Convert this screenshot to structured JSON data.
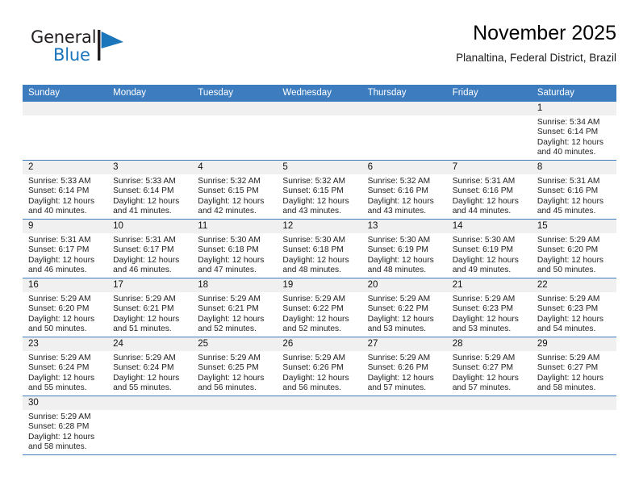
{
  "brand": {
    "name_dark": "General",
    "name_blue": "Blue",
    "flag_color": "#1b75bb"
  },
  "header": {
    "title": "November 2025",
    "subtitle": "Planaltina, Federal District, Brazil"
  },
  "theme": {
    "header_blue": "#3d7cbf",
    "daynum_gray": "#f0f0f0",
    "text": "#222222"
  },
  "weekdays": [
    "Sunday",
    "Monday",
    "Tuesday",
    "Wednesday",
    "Thursday",
    "Friday",
    "Saturday"
  ],
  "labels": {
    "sunrise_prefix": "Sunrise:",
    "sunset_prefix": "Sunset:",
    "daylight_prefix": "Daylight:"
  },
  "weeks": [
    [
      {
        "day": "",
        "sunrise": "",
        "sunset": "",
        "daylight_line1": "",
        "daylight_line2": ""
      },
      {
        "day": "",
        "sunrise": "",
        "sunset": "",
        "daylight_line1": "",
        "daylight_line2": ""
      },
      {
        "day": "",
        "sunrise": "",
        "sunset": "",
        "daylight_line1": "",
        "daylight_line2": ""
      },
      {
        "day": "",
        "sunrise": "",
        "sunset": "",
        "daylight_line1": "",
        "daylight_line2": ""
      },
      {
        "day": "",
        "sunrise": "",
        "sunset": "",
        "daylight_line1": "",
        "daylight_line2": ""
      },
      {
        "day": "",
        "sunrise": "",
        "sunset": "",
        "daylight_line1": "",
        "daylight_line2": ""
      },
      {
        "day": "1",
        "sunrise": "Sunrise: 5:34 AM",
        "sunset": "Sunset: 6:14 PM",
        "daylight_line1": "Daylight: 12 hours",
        "daylight_line2": "and 40 minutes."
      }
    ],
    [
      {
        "day": "2",
        "sunrise": "Sunrise: 5:33 AM",
        "sunset": "Sunset: 6:14 PM",
        "daylight_line1": "Daylight: 12 hours",
        "daylight_line2": "and 40 minutes."
      },
      {
        "day": "3",
        "sunrise": "Sunrise: 5:33 AM",
        "sunset": "Sunset: 6:14 PM",
        "daylight_line1": "Daylight: 12 hours",
        "daylight_line2": "and 41 minutes."
      },
      {
        "day": "4",
        "sunrise": "Sunrise: 5:32 AM",
        "sunset": "Sunset: 6:15 PM",
        "daylight_line1": "Daylight: 12 hours",
        "daylight_line2": "and 42 minutes."
      },
      {
        "day": "5",
        "sunrise": "Sunrise: 5:32 AM",
        "sunset": "Sunset: 6:15 PM",
        "daylight_line1": "Daylight: 12 hours",
        "daylight_line2": "and 43 minutes."
      },
      {
        "day": "6",
        "sunrise": "Sunrise: 5:32 AM",
        "sunset": "Sunset: 6:16 PM",
        "daylight_line1": "Daylight: 12 hours",
        "daylight_line2": "and 43 minutes."
      },
      {
        "day": "7",
        "sunrise": "Sunrise: 5:31 AM",
        "sunset": "Sunset: 6:16 PM",
        "daylight_line1": "Daylight: 12 hours",
        "daylight_line2": "and 44 minutes."
      },
      {
        "day": "8",
        "sunrise": "Sunrise: 5:31 AM",
        "sunset": "Sunset: 6:16 PM",
        "daylight_line1": "Daylight: 12 hours",
        "daylight_line2": "and 45 minutes."
      }
    ],
    [
      {
        "day": "9",
        "sunrise": "Sunrise: 5:31 AM",
        "sunset": "Sunset: 6:17 PM",
        "daylight_line1": "Daylight: 12 hours",
        "daylight_line2": "and 46 minutes."
      },
      {
        "day": "10",
        "sunrise": "Sunrise: 5:31 AM",
        "sunset": "Sunset: 6:17 PM",
        "daylight_line1": "Daylight: 12 hours",
        "daylight_line2": "and 46 minutes."
      },
      {
        "day": "11",
        "sunrise": "Sunrise: 5:30 AM",
        "sunset": "Sunset: 6:18 PM",
        "daylight_line1": "Daylight: 12 hours",
        "daylight_line2": "and 47 minutes."
      },
      {
        "day": "12",
        "sunrise": "Sunrise: 5:30 AM",
        "sunset": "Sunset: 6:18 PM",
        "daylight_line1": "Daylight: 12 hours",
        "daylight_line2": "and 48 minutes."
      },
      {
        "day": "13",
        "sunrise": "Sunrise: 5:30 AM",
        "sunset": "Sunset: 6:19 PM",
        "daylight_line1": "Daylight: 12 hours",
        "daylight_line2": "and 48 minutes."
      },
      {
        "day": "14",
        "sunrise": "Sunrise: 5:30 AM",
        "sunset": "Sunset: 6:19 PM",
        "daylight_line1": "Daylight: 12 hours",
        "daylight_line2": "and 49 minutes."
      },
      {
        "day": "15",
        "sunrise": "Sunrise: 5:29 AM",
        "sunset": "Sunset: 6:20 PM",
        "daylight_line1": "Daylight: 12 hours",
        "daylight_line2": "and 50 minutes."
      }
    ],
    [
      {
        "day": "16",
        "sunrise": "Sunrise: 5:29 AM",
        "sunset": "Sunset: 6:20 PM",
        "daylight_line1": "Daylight: 12 hours",
        "daylight_line2": "and 50 minutes."
      },
      {
        "day": "17",
        "sunrise": "Sunrise: 5:29 AM",
        "sunset": "Sunset: 6:21 PM",
        "daylight_line1": "Daylight: 12 hours",
        "daylight_line2": "and 51 minutes."
      },
      {
        "day": "18",
        "sunrise": "Sunrise: 5:29 AM",
        "sunset": "Sunset: 6:21 PM",
        "daylight_line1": "Daylight: 12 hours",
        "daylight_line2": "and 52 minutes."
      },
      {
        "day": "19",
        "sunrise": "Sunrise: 5:29 AM",
        "sunset": "Sunset: 6:22 PM",
        "daylight_line1": "Daylight: 12 hours",
        "daylight_line2": "and 52 minutes."
      },
      {
        "day": "20",
        "sunrise": "Sunrise: 5:29 AM",
        "sunset": "Sunset: 6:22 PM",
        "daylight_line1": "Daylight: 12 hours",
        "daylight_line2": "and 53 minutes."
      },
      {
        "day": "21",
        "sunrise": "Sunrise: 5:29 AM",
        "sunset": "Sunset: 6:23 PM",
        "daylight_line1": "Daylight: 12 hours",
        "daylight_line2": "and 53 minutes."
      },
      {
        "day": "22",
        "sunrise": "Sunrise: 5:29 AM",
        "sunset": "Sunset: 6:23 PM",
        "daylight_line1": "Daylight: 12 hours",
        "daylight_line2": "and 54 minutes."
      }
    ],
    [
      {
        "day": "23",
        "sunrise": "Sunrise: 5:29 AM",
        "sunset": "Sunset: 6:24 PM",
        "daylight_line1": "Daylight: 12 hours",
        "daylight_line2": "and 55 minutes."
      },
      {
        "day": "24",
        "sunrise": "Sunrise: 5:29 AM",
        "sunset": "Sunset: 6:24 PM",
        "daylight_line1": "Daylight: 12 hours",
        "daylight_line2": "and 55 minutes."
      },
      {
        "day": "25",
        "sunrise": "Sunrise: 5:29 AM",
        "sunset": "Sunset: 6:25 PM",
        "daylight_line1": "Daylight: 12 hours",
        "daylight_line2": "and 56 minutes."
      },
      {
        "day": "26",
        "sunrise": "Sunrise: 5:29 AM",
        "sunset": "Sunset: 6:26 PM",
        "daylight_line1": "Daylight: 12 hours",
        "daylight_line2": "and 56 minutes."
      },
      {
        "day": "27",
        "sunrise": "Sunrise: 5:29 AM",
        "sunset": "Sunset: 6:26 PM",
        "daylight_line1": "Daylight: 12 hours",
        "daylight_line2": "and 57 minutes."
      },
      {
        "day": "28",
        "sunrise": "Sunrise: 5:29 AM",
        "sunset": "Sunset: 6:27 PM",
        "daylight_line1": "Daylight: 12 hours",
        "daylight_line2": "and 57 minutes."
      },
      {
        "day": "29",
        "sunrise": "Sunrise: 5:29 AM",
        "sunset": "Sunset: 6:27 PM",
        "daylight_line1": "Daylight: 12 hours",
        "daylight_line2": "and 58 minutes."
      }
    ],
    [
      {
        "day": "30",
        "sunrise": "Sunrise: 5:29 AM",
        "sunset": "Sunset: 6:28 PM",
        "daylight_line1": "Daylight: 12 hours",
        "daylight_line2": "and 58 minutes."
      },
      {
        "day": "",
        "sunrise": "",
        "sunset": "",
        "daylight_line1": "",
        "daylight_line2": ""
      },
      {
        "day": "",
        "sunrise": "",
        "sunset": "",
        "daylight_line1": "",
        "daylight_line2": ""
      },
      {
        "day": "",
        "sunrise": "",
        "sunset": "",
        "daylight_line1": "",
        "daylight_line2": ""
      },
      {
        "day": "",
        "sunrise": "",
        "sunset": "",
        "daylight_line1": "",
        "daylight_line2": ""
      },
      {
        "day": "",
        "sunrise": "",
        "sunset": "",
        "daylight_line1": "",
        "daylight_line2": ""
      },
      {
        "day": "",
        "sunrise": "",
        "sunset": "",
        "daylight_line1": "",
        "daylight_line2": ""
      }
    ]
  ]
}
